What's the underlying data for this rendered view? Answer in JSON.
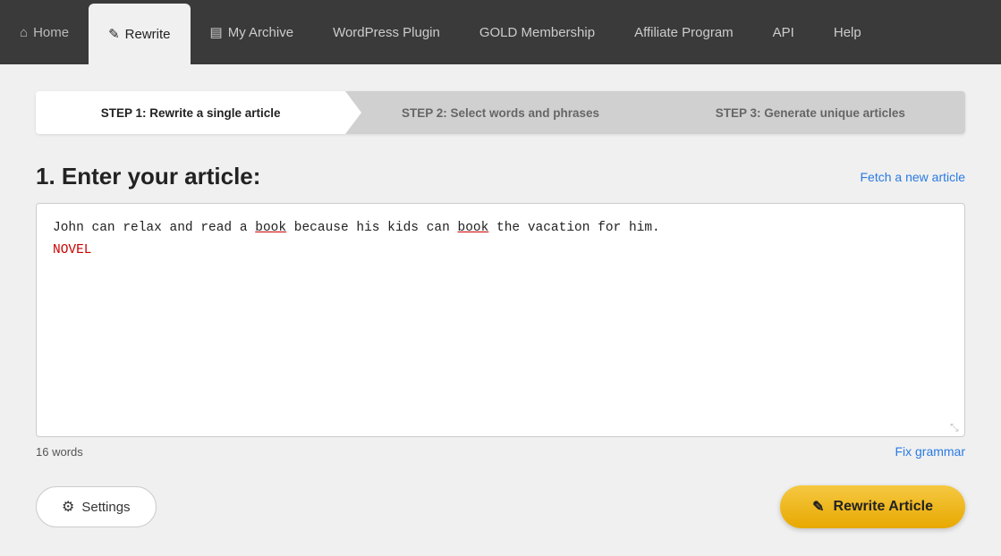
{
  "nav": {
    "home_label": "Home",
    "rewrite_label": "Rewrite",
    "archive_label": "My Archive",
    "wordpress_label": "WordPress Plugin",
    "gold_label": "GOLD Membership",
    "affiliate_label": "Affiliate Program",
    "api_label": "API",
    "help_label": "Help"
  },
  "steps": {
    "step1_label": "STEP 1: Rewrite a single article",
    "step2_label": "STEP 2: Select words and phrases",
    "step3_label": "STEP 3: Generate unique articles"
  },
  "main": {
    "section_title": "1. Enter your article:",
    "fetch_link": "Fetch a new article",
    "article_text": "John can relax and read a book because his kids can book the vacation for him.",
    "spell_word": "NOVEL",
    "word_count": "16 words",
    "fix_grammar": "Fix grammar",
    "settings_label": "Settings",
    "rewrite_label": "Rewrite Article"
  }
}
